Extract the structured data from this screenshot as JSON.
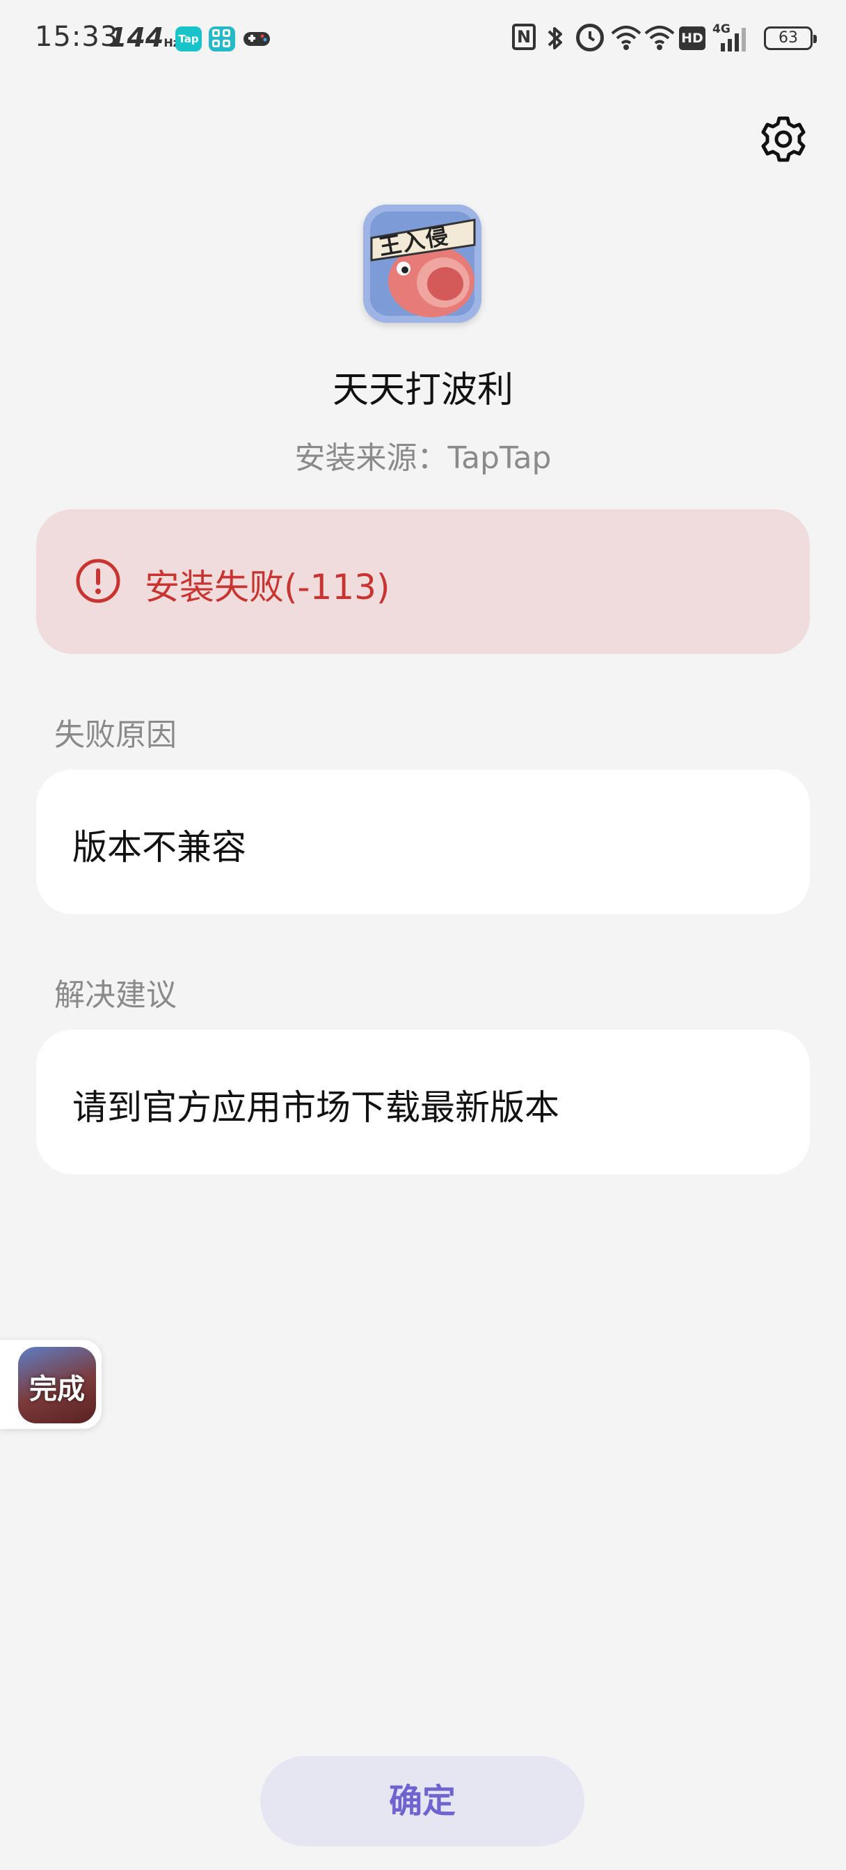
{
  "status_bar": {
    "time": "15:33",
    "refresh_rate": "144",
    "refresh_unit": "Hz",
    "tap_badge": "Tap",
    "hd": "HD",
    "network": "4G",
    "battery": "63"
  },
  "header": {
    "settings_icon": "gear-icon"
  },
  "app": {
    "name": "天天打波利",
    "source_label": "安装来源：",
    "source_value": "TapTap",
    "icon_banner": "王入侵"
  },
  "error": {
    "icon": "exclamation-circle-icon",
    "message": "安装失败(-113)",
    "color": "#c8342f"
  },
  "failure_reason": {
    "label": "失败原因",
    "value": "版本不兼容"
  },
  "suggestion": {
    "label": "解决建议",
    "value": "请到官方应用市场下载最新版本"
  },
  "floating_widget": {
    "label": "完成"
  },
  "footer": {
    "confirm_label": "确定",
    "accent": "#6f63cf"
  }
}
